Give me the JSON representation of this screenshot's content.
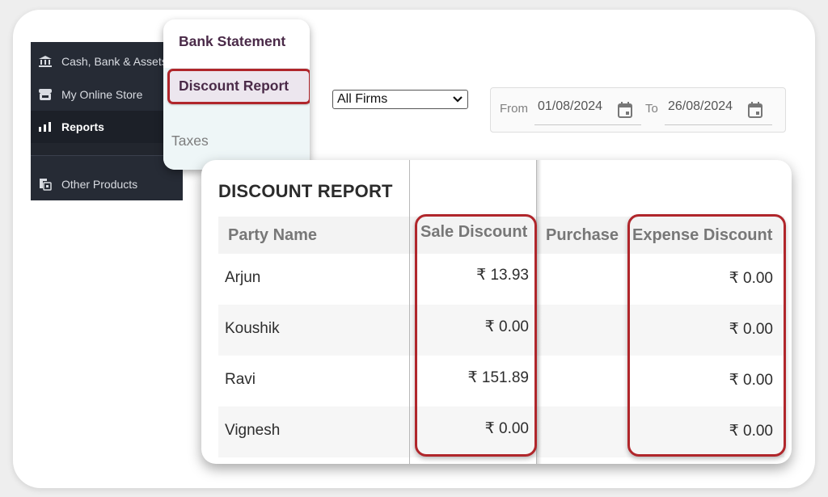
{
  "sidebar": {
    "items": [
      {
        "label": "Cash, Bank & Assets",
        "icon": "bank-icon",
        "active": false
      },
      {
        "label": "My Online Store",
        "icon": "store-icon",
        "active": false
      },
      {
        "label": "Reports",
        "icon": "bar-chart-icon",
        "active": true
      },
      {
        "label": "Other Products",
        "icon": "products-icon",
        "active": false
      }
    ]
  },
  "submenu": {
    "items": [
      {
        "label": "Bank Statement"
      },
      {
        "label": "Discount Report",
        "highlighted": true
      },
      {
        "label": "Taxes"
      }
    ]
  },
  "filters": {
    "firm_select": "All Firms",
    "from_label": "From",
    "from_date": "01/08/2024",
    "to_label": "To",
    "to_date": "26/08/2024"
  },
  "report": {
    "title": "DISCOUNT REPORT",
    "columns": [
      "Party Name",
      "Sale Discount",
      "Purchase",
      "Expense Discount"
    ],
    "rows": [
      {
        "party": "Arjun",
        "sale_discount": "₹ 13.93",
        "purchase": "",
        "expense_discount": "₹ 0.00"
      },
      {
        "party": "Koushik",
        "sale_discount": "₹ 0.00",
        "purchase": "",
        "expense_discount": "₹ 0.00"
      },
      {
        "party": "Ravi",
        "sale_discount": "₹ 151.89",
        "purchase": "",
        "expense_discount": "₹ 0.00"
      },
      {
        "party": "Vignesh",
        "sale_discount": "₹ 0.00",
        "purchase": "",
        "expense_discount": "₹ 0.00"
      }
    ]
  },
  "colors": {
    "highlight": "#b0262b",
    "sidebar_bg": "#262b35",
    "submenu_text": "#4a2a48"
  }
}
